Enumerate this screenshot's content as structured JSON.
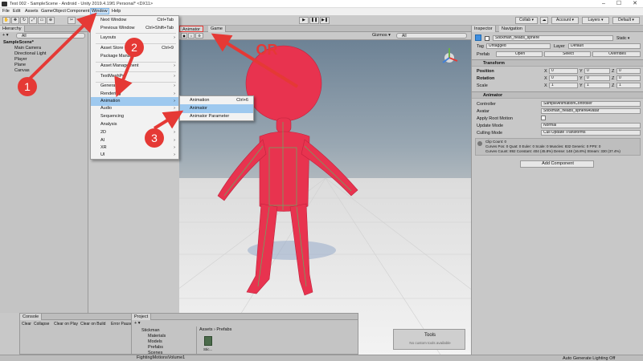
{
  "window": {
    "title": "Test 002 - SampleScene - Android - Unity 2019.4.19f1 Personal* <DX11>",
    "min": "–",
    "max": "☐",
    "close": "✕"
  },
  "menubar": [
    "File",
    "Edit",
    "Assets",
    "GameObject",
    "Component",
    "Window",
    "Help"
  ],
  "toolbar": {
    "collab": "Collab ▾",
    "account": "Account ▾",
    "layers": "Layers ▾",
    "layout": "Default ▾"
  },
  "hierarchy": {
    "tab": "Hierarchy",
    "add": "+ ▾",
    "search_placeholder": "All",
    "scene": "SampleScene*",
    "items": [
      "Main Camera",
      "Directional Light",
      "Player",
      "Plane",
      "Canvas"
    ]
  },
  "scene_view": {
    "tabs": [
      "Animator",
      "Game"
    ],
    "gizmos": "Gizmos ▾",
    "search_placeholder": "All"
  },
  "annotations": {
    "or": "OR",
    "numbers": [
      "1",
      "2",
      "3"
    ]
  },
  "window_menu": {
    "items": [
      {
        "label": "Next Window",
        "shortcut": "Ctrl+Tab"
      },
      {
        "label": "Previous Window",
        "shortcut": "Ctrl+Shift+Tab"
      },
      {
        "label": "Layouts",
        "arrow": "›"
      },
      {
        "label": "Asset Store",
        "shortcut": "Ctrl+9"
      },
      {
        "label": "Package Manager"
      },
      {
        "label": "Asset Management",
        "arrow": "›"
      },
      {
        "label": "TextMeshPro",
        "arrow": "›"
      },
      {
        "label": "General",
        "arrow": "›"
      },
      {
        "label": "Rendering",
        "arrow": "›"
      },
      {
        "label": "Animation",
        "arrow": "›"
      },
      {
        "label": "Audio",
        "arrow": "›"
      },
      {
        "label": "Sequencing",
        "arrow": "›"
      },
      {
        "label": "Analysis",
        "arrow": "›"
      },
      {
        "label": "2D",
        "arrow": "›"
      },
      {
        "label": "AI",
        "arrow": "›"
      },
      {
        "label": "XR",
        "arrow": "›"
      },
      {
        "label": "UI",
        "arrow": "›"
      }
    ]
  },
  "animation_submenu": {
    "items": [
      {
        "label": "Animation",
        "shortcut": "Ctrl+6"
      },
      {
        "label": "Animator"
      },
      {
        "label": "Animator Parameter"
      }
    ]
  },
  "inspector": {
    "tabs": [
      "Inspector",
      "Navigation"
    ],
    "object_name": "Stickman_heads_sphere",
    "static": "Static ▾",
    "tag_label": "Tag",
    "tag": "Untagged",
    "layer_label": "Layer",
    "layer": "Default",
    "prefab_label": "Prefab",
    "prefab_open": "Open",
    "prefab_select": "Select",
    "prefab_overrides": "Overrides",
    "transform": {
      "title": "Transform",
      "rows": [
        {
          "label": "Position",
          "x": "0",
          "y": "0",
          "z": "0"
        },
        {
          "label": "Rotation",
          "x": "0",
          "y": "0",
          "z": "0"
        },
        {
          "label": "Scale",
          "x": "1",
          "y": "1",
          "z": "1"
        }
      ]
    },
    "animator": {
      "title": "Animator",
      "controller_label": "Controller",
      "controller": "SampleAnimationController",
      "avatar_label": "Avatar",
      "avatar": "Stickman_heads_sphereAvatar",
      "apply_root_label": "Apply Root Motion",
      "update_mode_label": "Update Mode",
      "update_mode": "Normal",
      "culling_label": "Culling Mode",
      "culling": "Cull Update Transforms",
      "info": [
        "Clip Count: 0",
        "Curves Pos: 0 Quat: 0 Euler: 0 Scale: 0 Muscles: 832 Generic: 0 PPtr: 0",
        "Curves Count: 892 Constant: 404 (45.8%) Dense: 148 (16.8%) Stream: 330 (37.4%)"
      ]
    },
    "add_component": "Add Component"
  },
  "console": {
    "tab": "Console",
    "buttons": [
      "Clear",
      "Collapse",
      "Clear on Play",
      "Clear on Build",
      "Error Pause"
    ]
  },
  "project": {
    "tab": "Project",
    "add": "+ ▾",
    "tree": [
      "Stickman",
      "Materials",
      "Models",
      "Prefabs",
      "Scenes",
      "FightingMotionsVolume1"
    ],
    "breadcrumb": "Assets › Prefabs",
    "asset": "Stic..."
  },
  "tools": {
    "title": "Tools",
    "subtitle": "No custom tools available"
  },
  "status": "Auto Generate Lighting Off",
  "colors": {
    "arrow": "#e53935",
    "character": "#e8334f",
    "menu_sel": "#9ec9ef"
  }
}
